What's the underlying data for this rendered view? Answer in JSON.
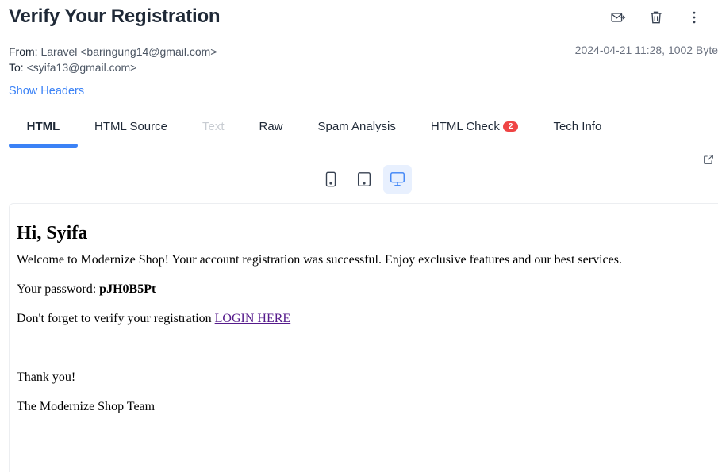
{
  "header": {
    "title": "Verify Your Registration"
  },
  "actions": [
    {
      "name": "forward-icon"
    },
    {
      "name": "trash-icon"
    },
    {
      "name": "more-vertical-icon"
    }
  ],
  "meta": {
    "from_label": "From:",
    "from_value": "Laravel <baringung14@gmail.com>",
    "to_label": "To:",
    "to_value": "<syifa13@gmail.com>",
    "date_size": "2024-04-21 11:28, 1002 Byte"
  },
  "show_headers": "Show Headers",
  "tabs": [
    {
      "label": "HTML",
      "active": true
    },
    {
      "label": "HTML Source"
    },
    {
      "label": "Text",
      "disabled": true
    },
    {
      "label": "Raw"
    },
    {
      "label": "Spam Analysis"
    },
    {
      "label": "HTML Check",
      "badge": "2"
    },
    {
      "label": "Tech Info"
    }
  ],
  "devices": [
    {
      "name": "phone-icon"
    },
    {
      "name": "tablet-icon"
    },
    {
      "name": "desktop-icon",
      "active": true
    }
  ],
  "email": {
    "greeting": "Hi, Syifa",
    "welcome": "Welcome to Modernize Shop! Your account registration was successful. Enjoy exclusive features and our best services.",
    "password_label": "Your password: ",
    "password_value": "pJH0B5Pt",
    "verify_text": "Don't forget to verify your registration ",
    "verify_link": "LOGIN HERE",
    "thanks": "Thank you!",
    "signature": "The Modernize Shop Team"
  },
  "colors": {
    "accent": "#3b82f6",
    "badge": "#ef4444",
    "link_visited": "#551a8b"
  }
}
